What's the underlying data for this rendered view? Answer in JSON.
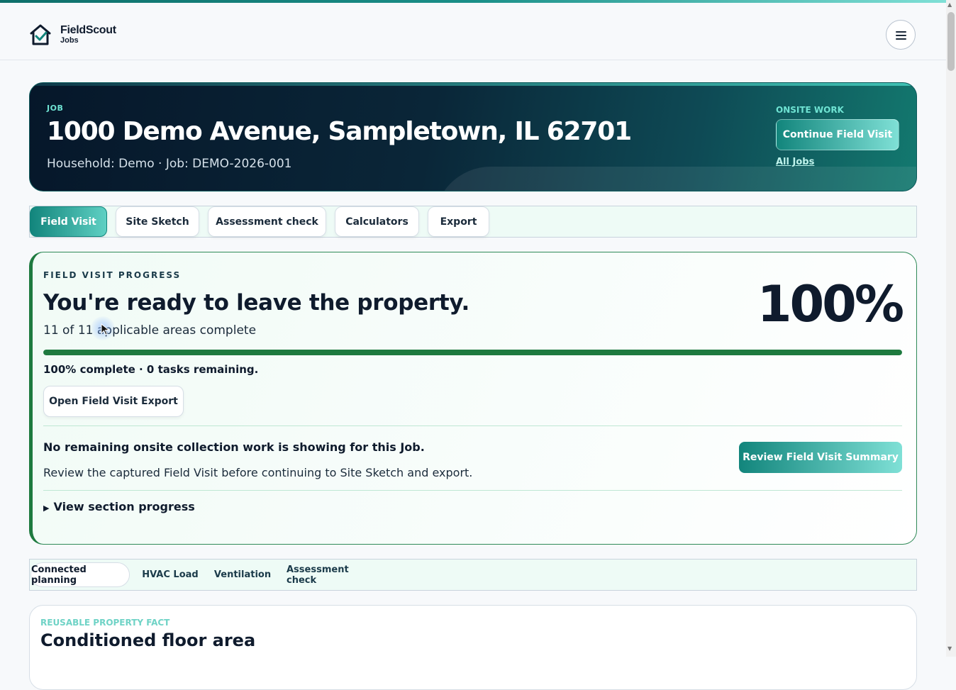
{
  "brand": {
    "name": "FieldScout",
    "sub": "Jobs",
    "logo_icon": "house-check-icon"
  },
  "header": {
    "menu_icon": "hamburger-menu-icon"
  },
  "hero": {
    "label": "JOB",
    "title": "1000 Demo Avenue, Sampletown, IL 62701",
    "subtitle": "Household: Demo · Job: DEMO-2026-001",
    "onsite_label": "ONSITE WORK",
    "continue_label": "Continue Field Visit",
    "all_jobs_label": "All Jobs"
  },
  "tabs": [
    {
      "label": "Field Visit",
      "active": true
    },
    {
      "label": "Site Sketch",
      "active": false
    },
    {
      "label": "Assessment check",
      "active": false
    },
    {
      "label": "Calculators",
      "active": false
    },
    {
      "label": "Export",
      "active": false
    }
  ],
  "progress": {
    "label": "FIELD VISIT PROGRESS",
    "title": "You're ready to leave the property.",
    "subtitle": "11 of 11 applicable areas complete",
    "percent_text": "100%",
    "percent_value": 100,
    "status": "100% complete · 0 tasks remaining.",
    "export_button": "Open Field Visit Export",
    "no_remaining": "No remaining onsite collection work is showing for this Job.",
    "review_text": "Review the captured Field Visit before continuing to Site Sketch and export.",
    "review_button": "Review Field Visit Summary",
    "section_toggle": "View section progress",
    "bar_color": "#1e7a3f"
  },
  "subtabs": [
    {
      "label": "Connected planning",
      "active": true
    },
    {
      "label": "HVAC Load",
      "active": false
    },
    {
      "label": "Ventilation",
      "active": false
    },
    {
      "label": "Assessment check",
      "active": false
    }
  ],
  "fact": {
    "label": "REUSABLE PROPERTY FACT",
    "title": "Conditioned floor area"
  },
  "colors": {
    "accent": "#12857c",
    "accent_light": "#7fe0d6",
    "dark": "#06172a",
    "success": "#1e7a3f"
  }
}
